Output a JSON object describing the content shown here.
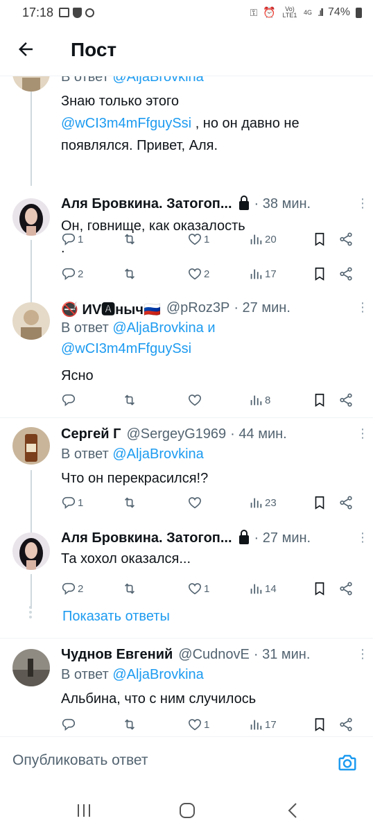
{
  "status": {
    "time": "17:18",
    "network": "Vo) LTE1",
    "net2": "4G",
    "battery": "74%"
  },
  "header": {
    "title": "Пост"
  },
  "tweets": [
    {
      "reply_prefix": "В ответ",
      "reply_handle": "@AljaBrovkina",
      "text_1": "Знаю только этого",
      "mention": "@wCI3m4mFfguySsi",
      "text_2": ", но он давно не",
      "text_3": "появлялся. Привет, Аля.",
      "replies": "1",
      "retweets": "",
      "likes": "1",
      "views": "20"
    },
    {
      "name": "Аля Бровкина. Затогоп...",
      "time": "· 38 мин.",
      "text_1": "Он, говнище, как оказалость",
      "text_2": ".",
      "replies": "2",
      "retweets": "",
      "likes": "2",
      "views": "17"
    },
    {
      "name": "🚭 ИV🅰ныч🇷🇺",
      "handle": "@pRoz3P",
      "time": "· 27 мин.",
      "reply_prefix": "В ответ",
      "reply_handle": "@AljaBrovkina",
      "reply_and": "и",
      "reply_handle2": "@wCI3m4mFfguySsi",
      "text_1": "Ясно",
      "replies": "",
      "retweets": "",
      "likes": "",
      "views": "8"
    },
    {
      "name": "Сергей Г",
      "handle": "@SergeyG1969",
      "time": "· 44 мин.",
      "reply_prefix": "В ответ",
      "reply_handle": "@AljaBrovkina",
      "text_1": "Что он перекрасился!?",
      "replies": "1",
      "retweets": "",
      "likes": "",
      "views": "23"
    },
    {
      "name": "Аля Бровкина. Затогоп...",
      "time": "· 27 мин.",
      "text_1": "Та хохол оказался...",
      "replies": "2",
      "retweets": "",
      "likes": "1",
      "views": "14"
    },
    {
      "name": "Чуднов Евгений",
      "handle": "@CudnovE",
      "time": "· 31 мин.",
      "reply_prefix": "В ответ",
      "reply_handle": "@AljaBrovkina",
      "text_1": "Альбина, что с ним случилось",
      "replies": "",
      "retweets": "",
      "likes": "1",
      "views": "17"
    }
  ],
  "show_replies": "Показать ответы",
  "compose": {
    "placeholder": "Опубликовать ответ"
  },
  "colors": {
    "accent": "#1d9bf0",
    "text": "#0f1419",
    "muted": "#536471",
    "line": "#cfd9de"
  },
  "icons": [
    "arrow-left-icon",
    "reply-icon",
    "retweet-icon",
    "heart-icon",
    "views-icon",
    "bookmark-icon",
    "share-icon",
    "lock-icon",
    "more-icon",
    "camera-icon"
  ]
}
